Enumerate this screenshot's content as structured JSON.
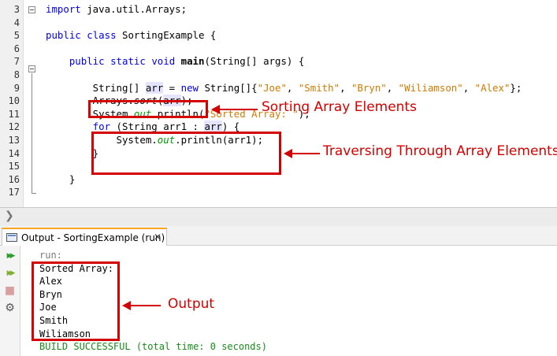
{
  "editor": {
    "lines": [
      {
        "num": "3",
        "parts": [
          {
            "t": "import",
            "c": "kw"
          },
          {
            "t": " java.util.Arrays;",
            "c": ""
          }
        ]
      },
      {
        "num": "4",
        "parts": []
      },
      {
        "num": "5",
        "parts": [
          {
            "t": "public",
            "c": "kw"
          },
          {
            "t": " ",
            "c": ""
          },
          {
            "t": "class",
            "c": "kw"
          },
          {
            "t": " SortingExample {",
            "c": ""
          }
        ]
      },
      {
        "num": "6",
        "parts": []
      },
      {
        "num": "7",
        "parts": [
          {
            "t": "    ",
            "c": ""
          },
          {
            "t": "public",
            "c": "kw"
          },
          {
            "t": " ",
            "c": ""
          },
          {
            "t": "static",
            "c": "kw"
          },
          {
            "t": " ",
            "c": ""
          },
          {
            "t": "void",
            "c": "kw"
          },
          {
            "t": " ",
            "c": ""
          },
          {
            "t": "main",
            "c": "bold"
          },
          {
            "t": "(String[] args) {",
            "c": ""
          }
        ]
      },
      {
        "num": "8",
        "parts": []
      },
      {
        "num": "9",
        "parts": [
          {
            "t": "        String[] ",
            "c": ""
          },
          {
            "t": "arr",
            "c": "hl"
          },
          {
            "t": " = ",
            "c": ""
          },
          {
            "t": "new",
            "c": "kw"
          },
          {
            "t": " String[]{",
            "c": ""
          },
          {
            "t": "\"Joe\"",
            "c": "str"
          },
          {
            "t": ", ",
            "c": ""
          },
          {
            "t": "\"Smith\"",
            "c": "str"
          },
          {
            "t": ", ",
            "c": ""
          },
          {
            "t": "\"Bryn\"",
            "c": "str"
          },
          {
            "t": ", ",
            "c": ""
          },
          {
            "t": "\"Wiliamson\"",
            "c": "str"
          },
          {
            "t": ", ",
            "c": ""
          },
          {
            "t": "\"Alex\"",
            "c": "str"
          },
          {
            "t": "};",
            "c": ""
          }
        ]
      },
      {
        "num": "10",
        "parts": [
          {
            "t": "        Arrays.",
            "c": ""
          },
          {
            "t": "sort",
            "c": "it"
          },
          {
            "t": "(",
            "c": ""
          },
          {
            "t": "arr",
            "c": "hl"
          },
          {
            "t": ");",
            "c": ""
          }
        ]
      },
      {
        "num": "11",
        "parts": [
          {
            "t": "        System.",
            "c": ""
          },
          {
            "t": "out",
            "c": "fld"
          },
          {
            "t": ".println(",
            "c": ""
          },
          {
            "t": "\"Sorted Array: \"",
            "c": "str"
          },
          {
            "t": ");",
            "c": ""
          }
        ]
      },
      {
        "num": "12",
        "parts": [
          {
            "t": "        ",
            "c": ""
          },
          {
            "t": "for",
            "c": "kw"
          },
          {
            "t": " (String arr1 : ",
            "c": ""
          },
          {
            "t": "arr",
            "c": "hl"
          },
          {
            "t": ") {",
            "c": ""
          }
        ]
      },
      {
        "num": "13",
        "parts": [
          {
            "t": "            System.",
            "c": ""
          },
          {
            "t": "out",
            "c": "fld"
          },
          {
            "t": ".println(arr1);",
            "c": ""
          }
        ]
      },
      {
        "num": "14",
        "parts": [
          {
            "t": "        }",
            "c": ""
          }
        ]
      },
      {
        "num": "15",
        "parts": []
      },
      {
        "num": "16",
        "parts": [
          {
            "t": "    }",
            "c": ""
          }
        ]
      },
      {
        "num": "17",
        "parts": []
      }
    ]
  },
  "annotations": {
    "sorting": "Sorting Array Elements",
    "traversing": "Traversing Through Array Elements",
    "output": "Output"
  },
  "output_panel": {
    "tab_label": "Output - SortingExample (run)",
    "close_glyph": "✕",
    "side_buttons": [
      {
        "name": "rerun-icon",
        "glyph": "▶▶",
        "color": "#2f9e2f"
      },
      {
        "name": "rerun-with-args-icon",
        "glyph": "▶▶",
        "color": "#7fae2f"
      },
      {
        "name": "stop-icon",
        "glyph": "■",
        "color": "#d9a0a0"
      },
      {
        "name": "settings-icon",
        "glyph": "⚙",
        "color": "#555555"
      }
    ],
    "lines": [
      {
        "text": "run:",
        "style": "run"
      },
      {
        "text": "Sorted Array: ",
        "style": ""
      },
      {
        "text": "Alex",
        "style": ""
      },
      {
        "text": "Bryn",
        "style": ""
      },
      {
        "text": "Joe",
        "style": ""
      },
      {
        "text": "Smith",
        "style": ""
      },
      {
        "text": "Wiliamson",
        "style": ""
      },
      {
        "text": "BUILD SUCCESSFUL (total time: 0 seconds)",
        "style": "build"
      }
    ]
  },
  "splitter": {
    "glyph": "❯"
  },
  "colors": {
    "annotation": "#d40000",
    "keyword": "#0000e6",
    "string": "#ce7b00",
    "field": "#009900"
  }
}
